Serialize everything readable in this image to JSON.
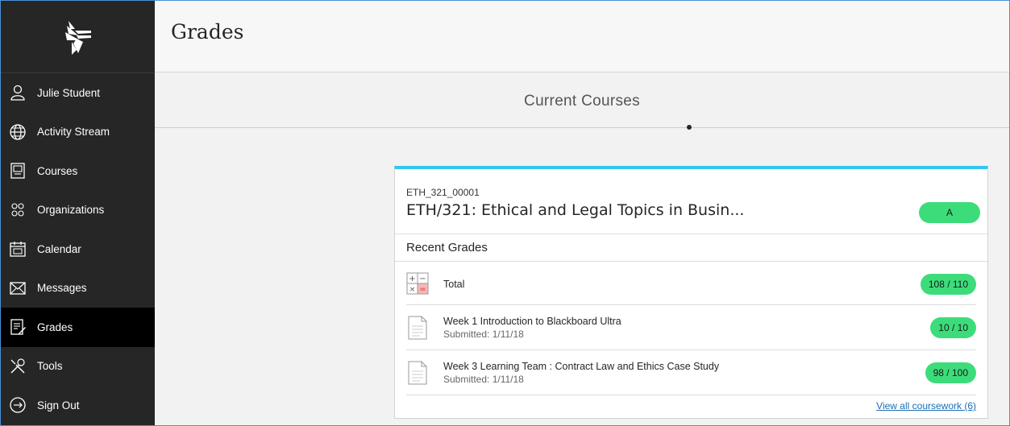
{
  "sidebar": {
    "items": [
      {
        "label": "Julie Student",
        "icon": "user-icon"
      },
      {
        "label": "Activity Stream",
        "icon": "globe-icon"
      },
      {
        "label": "Courses",
        "icon": "courses-icon"
      },
      {
        "label": "Organizations",
        "icon": "organizations-icon"
      },
      {
        "label": "Calendar",
        "icon": "calendar-icon"
      },
      {
        "label": "Messages",
        "icon": "envelope-icon"
      },
      {
        "label": "Grades",
        "icon": "grades-icon",
        "active": true
      },
      {
        "label": "Tools",
        "icon": "tools-icon"
      },
      {
        "label": "Sign Out",
        "icon": "sign-out-icon"
      }
    ]
  },
  "header": {
    "title": "Grades"
  },
  "section": {
    "title": "Current Courses"
  },
  "course": {
    "id": "ETH_321_00001",
    "name": "ETH/321: Ethical and Legal Topics in Busin...",
    "grade": "A",
    "recent_grades_label": "Recent Grades",
    "rows": [
      {
        "title": "Total",
        "subtitle": "",
        "score": "108 / 110",
        "icon": "calculator-icon"
      },
      {
        "title": "Week 1 Introduction to Blackboard Ultra",
        "subtitle": "Submitted: 1/11/18",
        "score": "10 / 10",
        "icon": "document-icon"
      },
      {
        "title": "Week 3 Learning Team : Contract Law and Ethics Case Study",
        "subtitle": "Submitted: 1/11/18",
        "score": "98 / 100",
        "icon": "document-icon"
      }
    ],
    "view_all": "View all coursework (6)"
  },
  "colors": {
    "sidebar_bg": "#262626",
    "active_item_bg": "#000000",
    "card_accent": "#31c8f0",
    "grade_pill": "#3ddc7a",
    "link": "#1a6fb5"
  }
}
